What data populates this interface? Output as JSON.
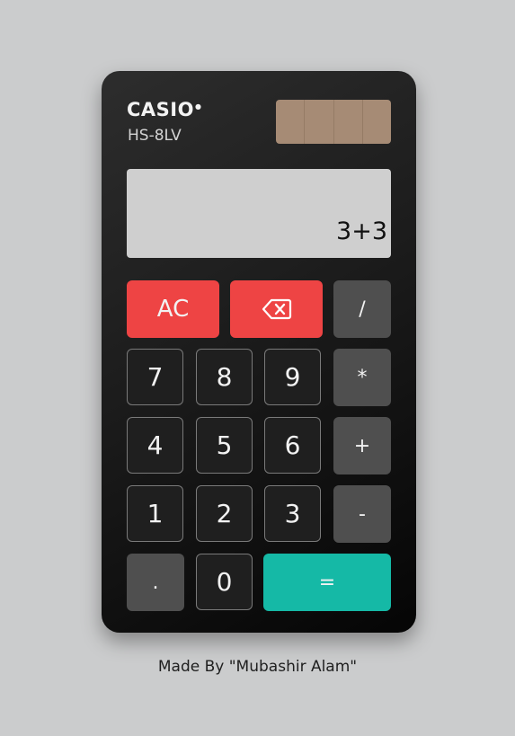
{
  "brand": {
    "logo": "CASIO",
    "model": "HS-8LV"
  },
  "display": {
    "expression": "3+3"
  },
  "keys": {
    "ac": "AC",
    "divide": "/",
    "multiply": "*",
    "add": "+",
    "subtract": "-",
    "decimal": ".",
    "equals": "=",
    "digits": [
      "0",
      "1",
      "2",
      "3",
      "4",
      "5",
      "6",
      "7",
      "8",
      "9"
    ]
  },
  "icons": {
    "backspace": "backspace-icon"
  },
  "colors": {
    "clear": "#ee4444",
    "equals": "#15b9a6",
    "operator": "#4f4f4f",
    "body": "#1c1c1c",
    "solar_panel": "#a68b75",
    "screen": "#cfcfcf"
  },
  "footer": {
    "credit": "Made By \"Mubashir Alam\""
  }
}
